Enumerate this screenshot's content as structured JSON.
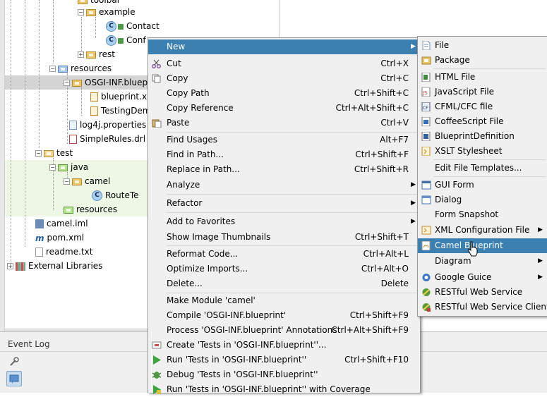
{
  "project_tree": {
    "items": [
      {
        "label": "toolbar"
      },
      {
        "label": "example"
      },
      {
        "label": "Contact"
      },
      {
        "label": "Conf"
      },
      {
        "label": "rest"
      },
      {
        "label": "resources"
      },
      {
        "label": "OSGI-INF.bluep"
      },
      {
        "label": "blueprint.xm"
      },
      {
        "label": "TestingDem"
      },
      {
        "label": "log4j.properties"
      },
      {
        "label": "SimpleRules.drl"
      },
      {
        "label": "test"
      },
      {
        "label": "java"
      },
      {
        "label": "camel"
      },
      {
        "label": "RouteTe"
      },
      {
        "label": "resources"
      },
      {
        "label": "camel.iml"
      },
      {
        "label": "pom.xml"
      },
      {
        "label": "readme.txt"
      },
      {
        "label": "External Libraries"
      }
    ]
  },
  "event_log": {
    "title": "Event Log"
  },
  "context_menu": {
    "items": [
      {
        "label": "New",
        "shortcut": "",
        "has_submenu": true
      },
      {
        "label": "Cut",
        "shortcut": "Ctrl+X"
      },
      {
        "label": "Copy",
        "shortcut": "Ctrl+C"
      },
      {
        "label": "Copy Path",
        "shortcut": "Ctrl+Shift+C"
      },
      {
        "label": "Copy Reference",
        "shortcut": "Ctrl+Alt+Shift+C"
      },
      {
        "label": "Paste",
        "shortcut": "Ctrl+V"
      },
      {
        "label": "Find Usages",
        "shortcut": "Alt+F7"
      },
      {
        "label": "Find in Path...",
        "shortcut": "Ctrl+Shift+F"
      },
      {
        "label": "Replace in Path...",
        "shortcut": "Ctrl+Shift+R"
      },
      {
        "label": "Analyze",
        "shortcut": "",
        "has_submenu": true
      },
      {
        "label": "Refactor",
        "shortcut": "",
        "has_submenu": true
      },
      {
        "label": "Add to Favorites",
        "shortcut": "",
        "has_submenu": true
      },
      {
        "label": "Show Image Thumbnails",
        "shortcut": "Ctrl+Shift+T"
      },
      {
        "label": "Reformat Code...",
        "shortcut": "Ctrl+Alt+L"
      },
      {
        "label": "Optimize Imports...",
        "shortcut": "Ctrl+Alt+O"
      },
      {
        "label": "Delete...",
        "shortcut": "Delete"
      },
      {
        "label": "Make Module 'camel'",
        "shortcut": ""
      },
      {
        "label": "Compile 'OSGI-INF.blueprint'",
        "shortcut": "Ctrl+Shift+F9"
      },
      {
        "label": "Process 'OSGI-INF.blueprint' Annotations",
        "shortcut": "Ctrl+Alt+Shift+F9"
      },
      {
        "label": "Create 'Tests in 'OSGI-INF.blueprint''...",
        "shortcut": ""
      },
      {
        "label": "Run 'Tests in 'OSGI-INF.blueprint''",
        "shortcut": "Ctrl+Shift+F10"
      },
      {
        "label": "Debug 'Tests in 'OSGI-INF.blueprint''",
        "shortcut": ""
      },
      {
        "label": "Run 'Tests in 'OSGI-INF.blueprint'' with Coverage",
        "shortcut": ""
      }
    ]
  },
  "new_submenu": {
    "items": [
      {
        "label": "File"
      },
      {
        "label": "Package"
      },
      {
        "label": "HTML File"
      },
      {
        "label": "JavaScript File"
      },
      {
        "label": "CFML/CFC file"
      },
      {
        "label": "CoffeeScript File"
      },
      {
        "label": "BlueprintDefinition"
      },
      {
        "label": "XSLT Stylesheet"
      },
      {
        "label": "Edit File Templates..."
      },
      {
        "label": "GUI Form"
      },
      {
        "label": "Dialog"
      },
      {
        "label": "Form Snapshot"
      },
      {
        "label": "XML Configuration File",
        "has_submenu": true
      },
      {
        "label": "Camel Blueprint"
      },
      {
        "label": "Diagram",
        "has_submenu": true
      },
      {
        "label": "Google Guice",
        "has_submenu": true
      },
      {
        "label": "RESTful Web Service"
      },
      {
        "label": "RESTful Web Service Client"
      }
    ]
  },
  "colors": {
    "highlight": "#3c7fb1",
    "selected_row": "#d4d4d4",
    "test_band": "#eef7e6"
  }
}
